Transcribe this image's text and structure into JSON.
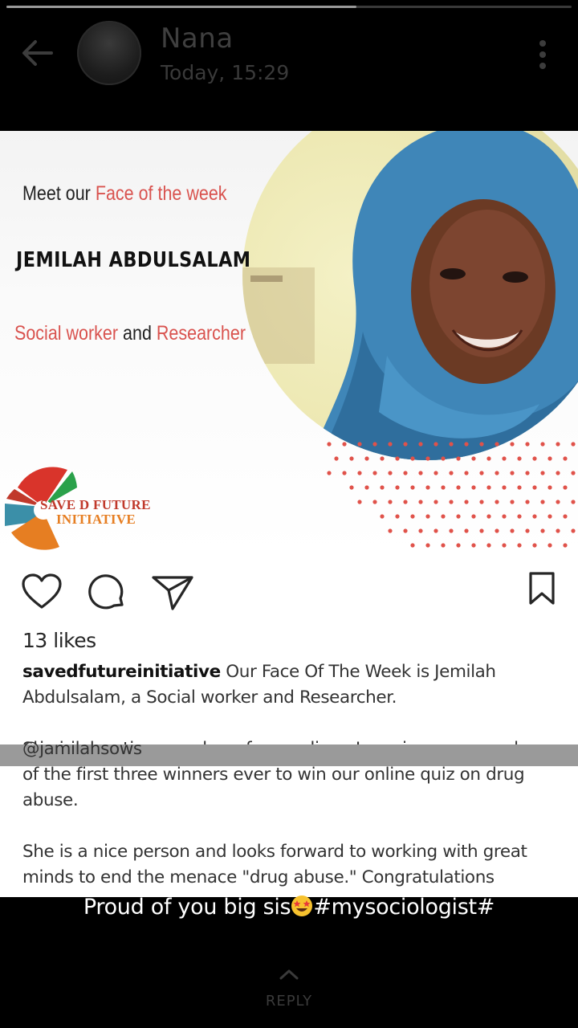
{
  "story": {
    "progress": 0.62
  },
  "header": {
    "contact_name": "Nana",
    "timestamp": "Today, 15:29"
  },
  "post": {
    "banner": {
      "meet_prefix": "Meet our ",
      "meet_accent": "Face of the week",
      "person_name": "JEMILAH ABDULSALAM",
      "role_accent_1": "Social worker",
      "role_connector": " and ",
      "role_accent_2": "Researcher",
      "logo_line1": "SAVE D FUTURE",
      "logo_line2": "INITIATIVE"
    },
    "likes": "13 likes",
    "caption": {
      "username": "savedfutureinitiative",
      "paragraph1": " Our Face Of The Week is Jemilah Abdulsalam, a Social worker and Researcher.",
      "paragraph2": "She is an active member of our online eLearning group and one of the first three winners ever to win our online quiz on drug abuse.",
      "paragraph3": "She is a nice person and looks forward to working with great minds to end the menace \"drug abuse.\" Congratulations",
      "mention": "@jamilahsows"
    }
  },
  "story_caption": {
    "before_emoji": "Proud of you big sis",
    "emoji": "star-struck-emoji",
    "after_emoji": "#mysociologist#"
  },
  "reply": {
    "label": "REPLY"
  },
  "colors": {
    "accent_red": "#d9534f",
    "background": "#000000"
  }
}
